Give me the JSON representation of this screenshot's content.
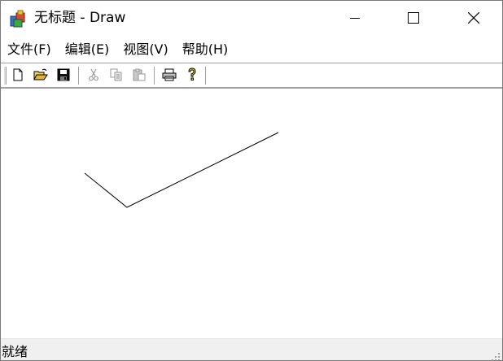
{
  "window": {
    "title": "无标题 - Draw"
  },
  "menubar": {
    "items": [
      {
        "label": "文件(F)"
      },
      {
        "label": "编辑(E)"
      },
      {
        "label": "视图(V)"
      },
      {
        "label": "帮助(H)"
      }
    ]
  },
  "toolbar": {
    "buttons": [
      {
        "icon": "new-file-icon",
        "enabled": true
      },
      {
        "icon": "open-folder-icon",
        "enabled": true
      },
      {
        "icon": "save-icon",
        "enabled": true
      },
      {
        "icon": "cut-icon",
        "enabled": false
      },
      {
        "icon": "copy-icon",
        "enabled": false
      },
      {
        "icon": "paste-icon",
        "enabled": false
      },
      {
        "icon": "print-icon",
        "enabled": true
      },
      {
        "icon": "help-icon",
        "enabled": true
      }
    ]
  },
  "canvas": {
    "polyline": "freehand line drawing"
  },
  "statusbar": {
    "text": "就绪"
  },
  "colors": {
    "window_bg": "#ffffff",
    "statusbar_bg": "#f0f0f0",
    "stroke": "#000000",
    "disabled_icon": "#9a9a9a"
  }
}
